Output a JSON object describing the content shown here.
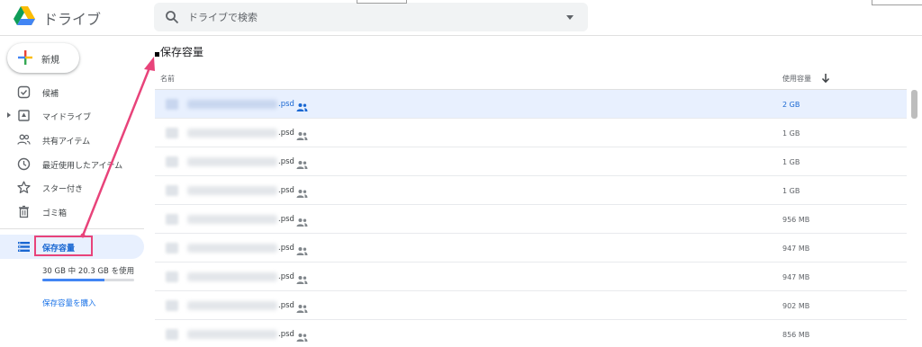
{
  "header": {
    "app_title": "ドライブ",
    "search_placeholder": "ドライブで検索"
  },
  "sidebar": {
    "new_label": "新規",
    "items": [
      {
        "label": "候補",
        "icon": "check-box-icon"
      },
      {
        "label": "マイドライブ",
        "icon": "drive-icon"
      },
      {
        "label": "共有アイテム",
        "icon": "people-icon"
      },
      {
        "label": "最近使用したアイテム",
        "icon": "clock-icon"
      },
      {
        "label": "スター付き",
        "icon": "star-icon"
      },
      {
        "label": "ゴミ箱",
        "icon": "trash-icon"
      }
    ],
    "storage": {
      "label": "保存容量",
      "usage_text": "30 GB 中 20.3 GB を使用",
      "used_fraction": 0.68,
      "buy_label": "保存容量を購入"
    }
  },
  "main": {
    "title": "保存容量",
    "columns": {
      "name": "名前",
      "size": "使用容量"
    },
    "rows": [
      {
        "name": ".psd",
        "size": "2 GB",
        "selected": true
      },
      {
        "name": ".psd",
        "size": "1 GB"
      },
      {
        "name": ".psd",
        "size": "1 GB"
      },
      {
        "name": ".psd",
        "size": "1 GB"
      },
      {
        "name": ".psd",
        "size": "956 MB"
      },
      {
        "name": ".psd",
        "size": "947 MB"
      },
      {
        "name": ".psd",
        "size": "947 MB"
      },
      {
        "name": ".psd",
        "size": "902 MB"
      },
      {
        "name": ".psd",
        "size": "856 MB"
      }
    ]
  },
  "colors": {
    "accent": "#1a73e8",
    "selected_bg": "#e8f0fe",
    "annotation": "#e8437a"
  }
}
